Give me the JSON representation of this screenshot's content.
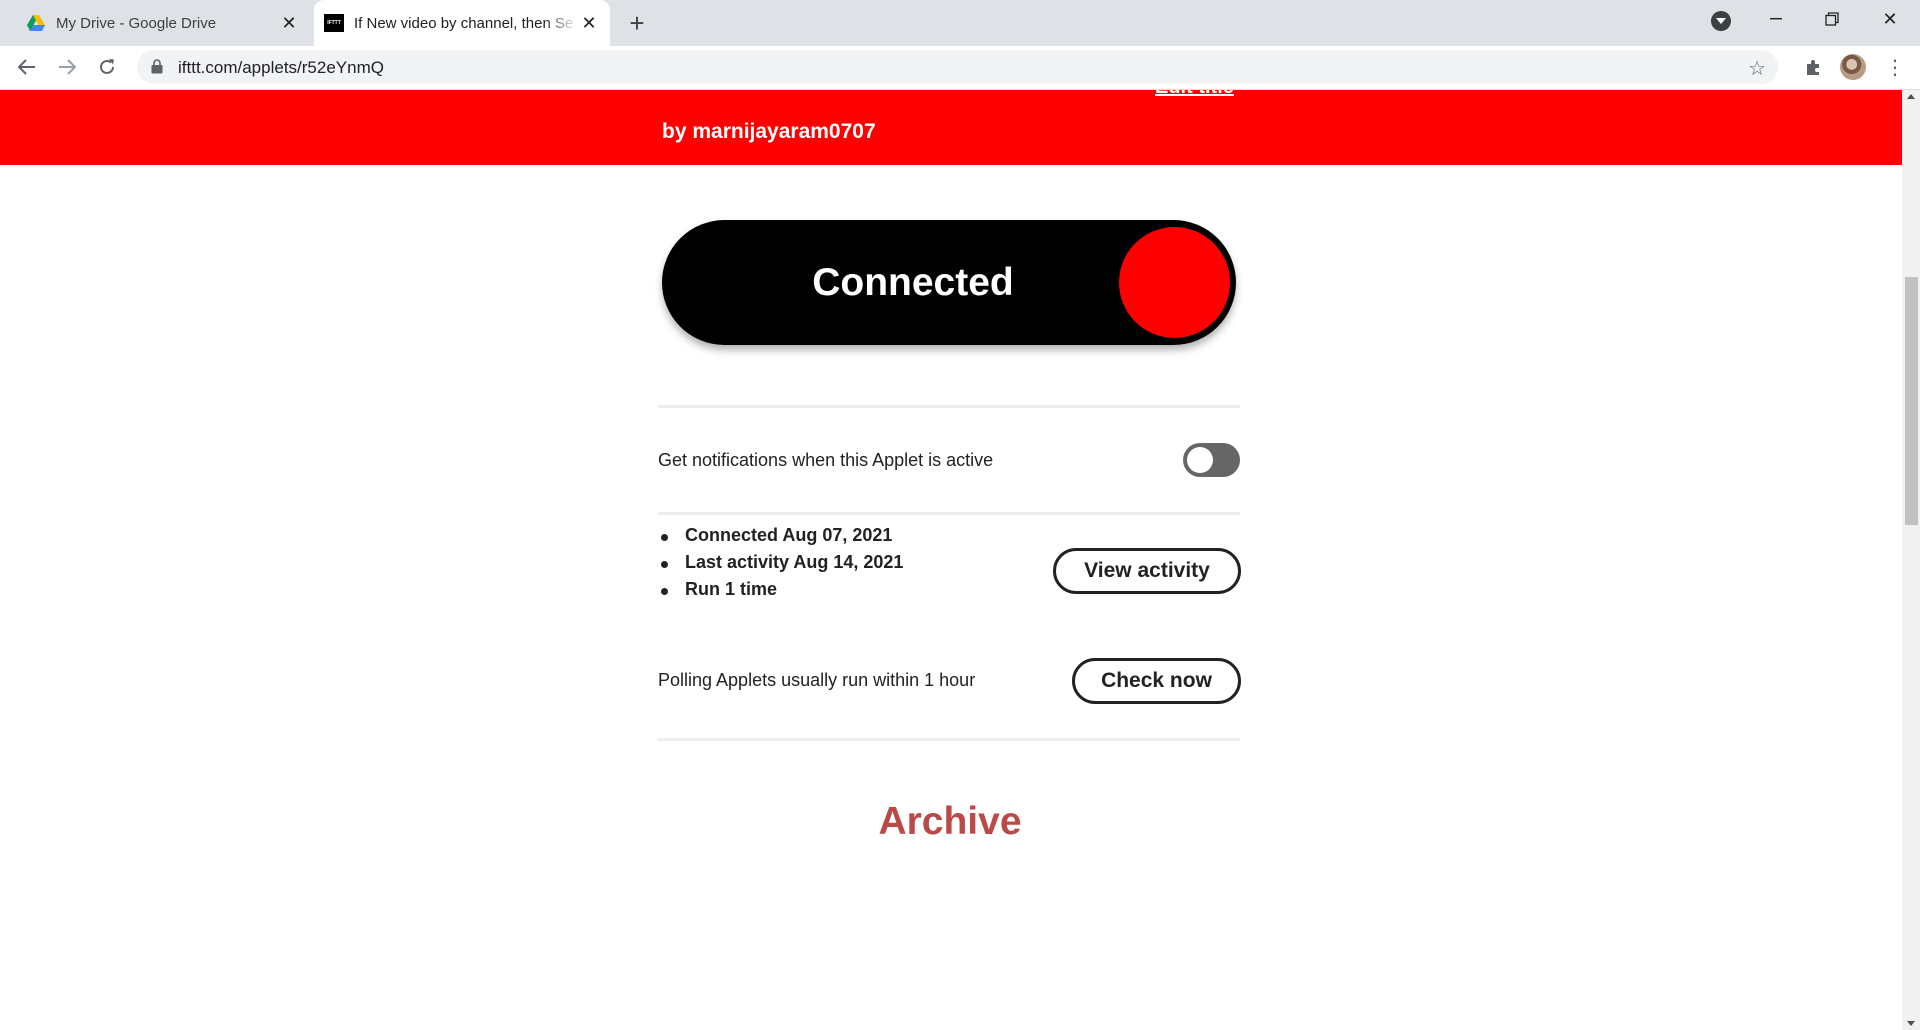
{
  "browser": {
    "tabs": [
      {
        "title": "My Drive - Google Drive",
        "icon": "google-drive-icon",
        "active": false
      },
      {
        "title": "If New video by channel, then Se",
        "icon": "ifttt-icon",
        "favicon_text": "IFTTT",
        "active": true
      }
    ],
    "url": "ifttt.com/applets/r52eYnmQ"
  },
  "applet": {
    "edit_title": "Edit title",
    "byline": "by marnijayaram0707",
    "connect_label": "Connected",
    "notifications_label": "Get notifications when this Applet is active",
    "notifications_enabled": false,
    "stats": [
      "Connected Aug 07, 2021",
      "Last activity Aug 14, 2021",
      "Run 1 time"
    ],
    "view_activity_label": "View activity",
    "polling_text": "Polling Applets usually run within 1 hour",
    "check_now_label": "Check now",
    "archive_label": "Archive"
  },
  "colors": {
    "brand_red": "#ff0000",
    "toggle_black": "#000000",
    "archive_red": "#b94a48",
    "switch_off": "#666666"
  }
}
